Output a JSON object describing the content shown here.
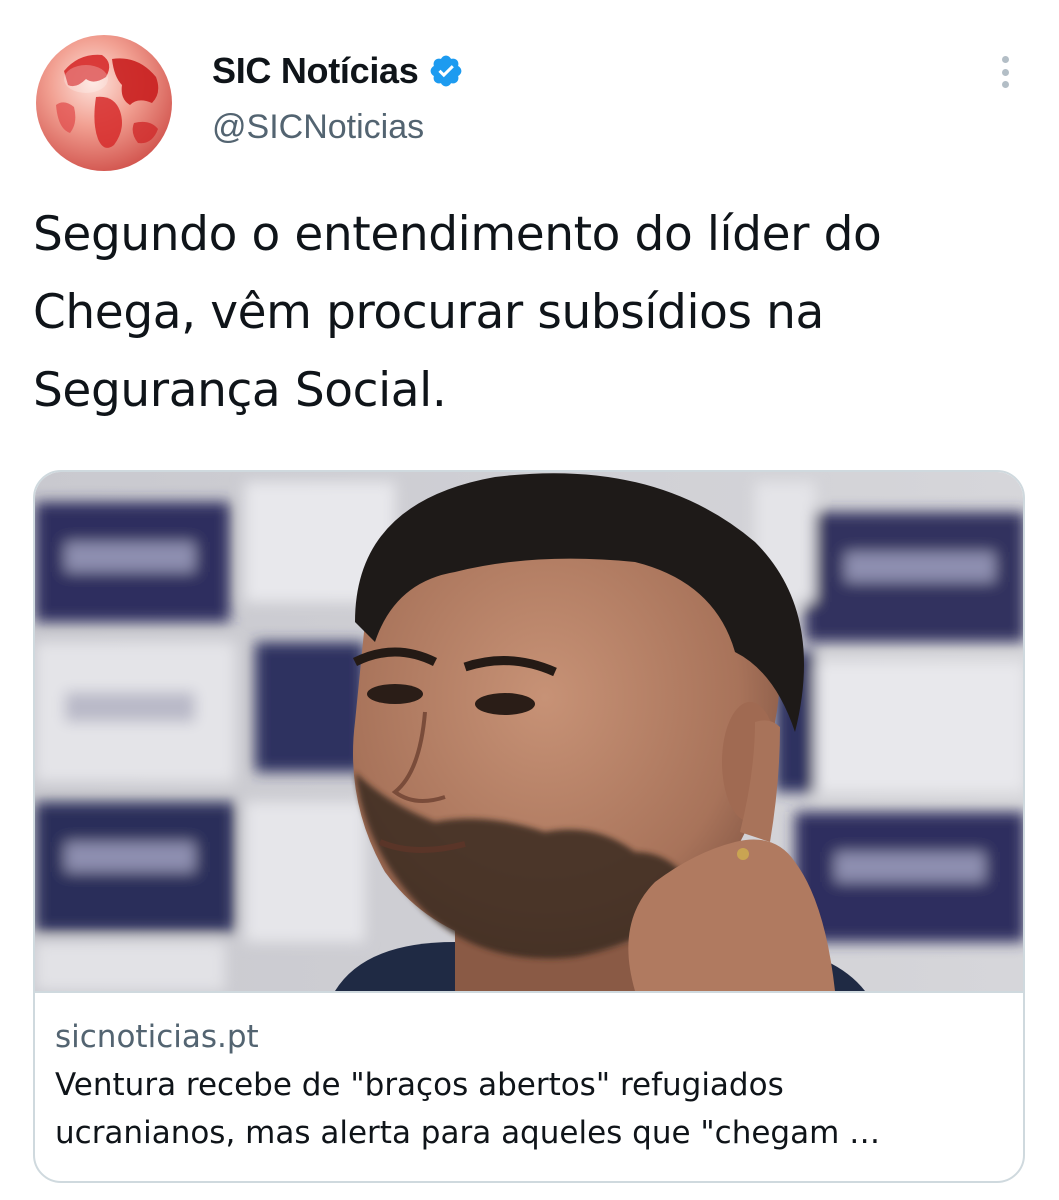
{
  "author": {
    "display_name": "SIC Notícias",
    "handle": "@SICNoticias",
    "verified": true,
    "avatar_icon": "red-globe-logo"
  },
  "tweet": {
    "text_lines": [
      "Segundo o entendimento do líder do",
      "Chega, vêm procurar subsídios na",
      "Segurança Social."
    ]
  },
  "link_card": {
    "image": "photo-of-man-at-press-conference",
    "domain": "sicnoticias.pt",
    "title_lines": [
      "Ventura recebe de \"braços abertos\" refugiados",
      "ucranianos, mas alerta para aqueles que \"chegam …"
    ]
  },
  "colors": {
    "text_primary": "#0f1419",
    "text_secondary": "#536471",
    "verified_blue": "#1d9bf0",
    "card_border": "#cfd9de",
    "logo_red": "#d42a2a"
  }
}
